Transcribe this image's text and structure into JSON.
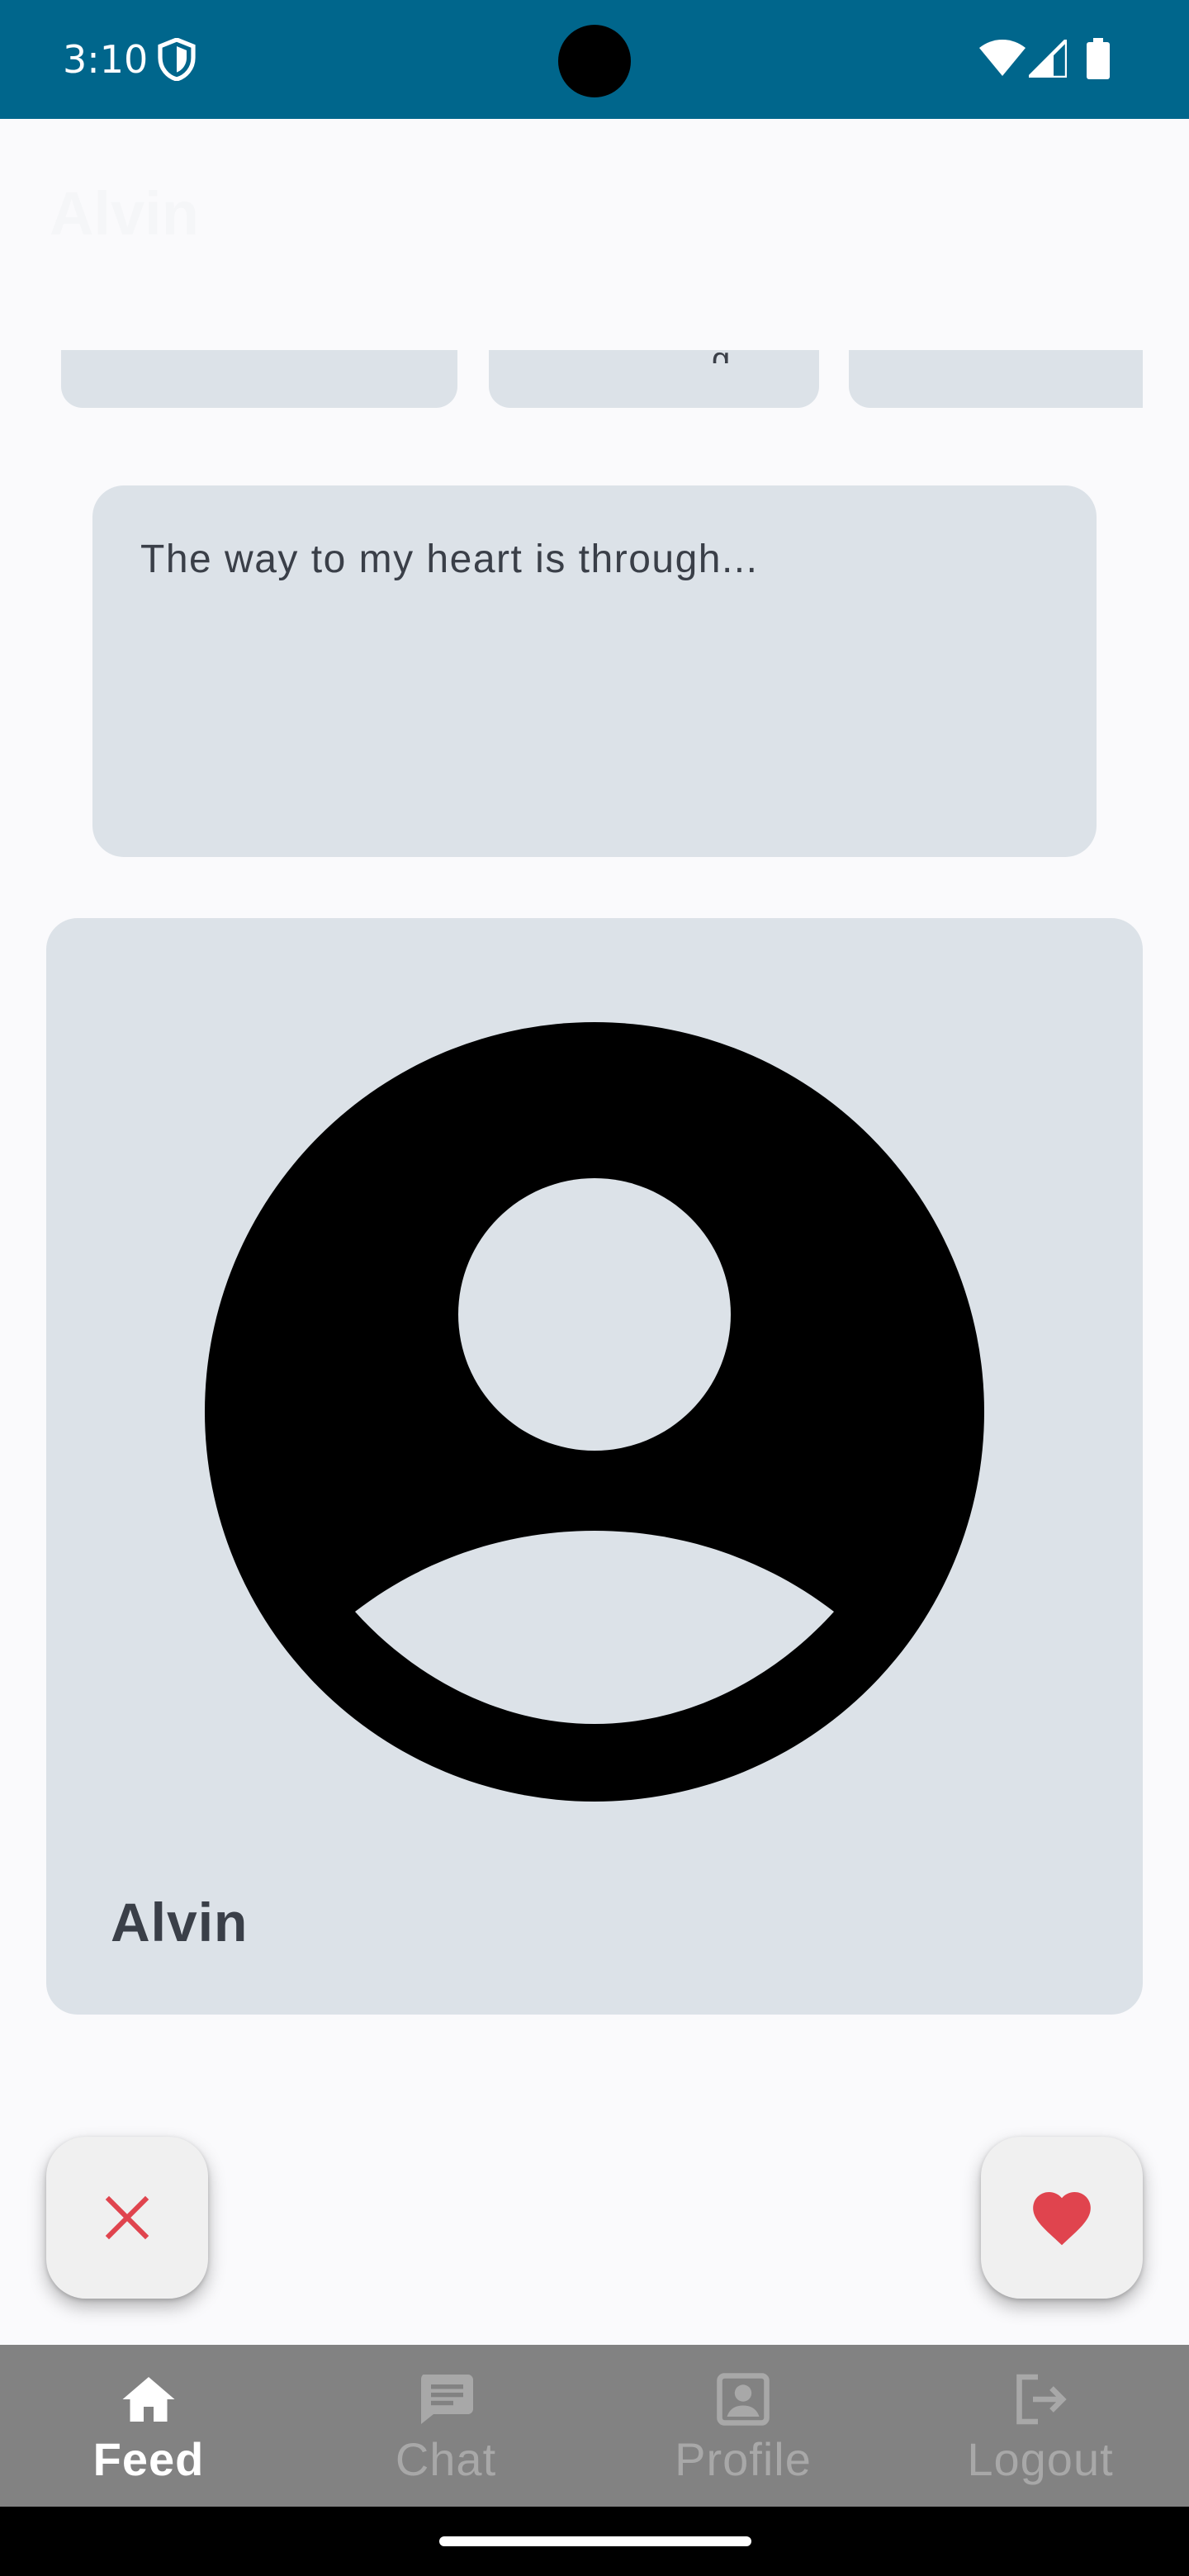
{
  "status_bar": {
    "time": "3:10",
    "icons": [
      "shield-icon",
      "wifi-icon",
      "cell-signal-icon",
      "battery-icon"
    ],
    "background_color": "#00668c"
  },
  "app_bar": {
    "title": "Alvin"
  },
  "prompt_chips": {
    "visible_glyph": "g"
  },
  "prompt_card": {
    "text": "The way to my heart is through..."
  },
  "profile_card": {
    "avatar_icon": "account-circle-icon",
    "name": "Alvin"
  },
  "actions": {
    "dislike_icon": "close-icon",
    "dislike_color": "#e0444e",
    "like_icon": "heart-icon",
    "like_color": "#e0444e"
  },
  "bottom_nav": {
    "items": [
      {
        "label": "Feed",
        "icon": "home-icon",
        "active": true
      },
      {
        "label": "Chat",
        "icon": "chat-icon",
        "active": false
      },
      {
        "label": "Profile",
        "icon": "profile-icon",
        "active": false
      },
      {
        "label": "Logout",
        "icon": "logout-icon",
        "active": false
      }
    ]
  }
}
